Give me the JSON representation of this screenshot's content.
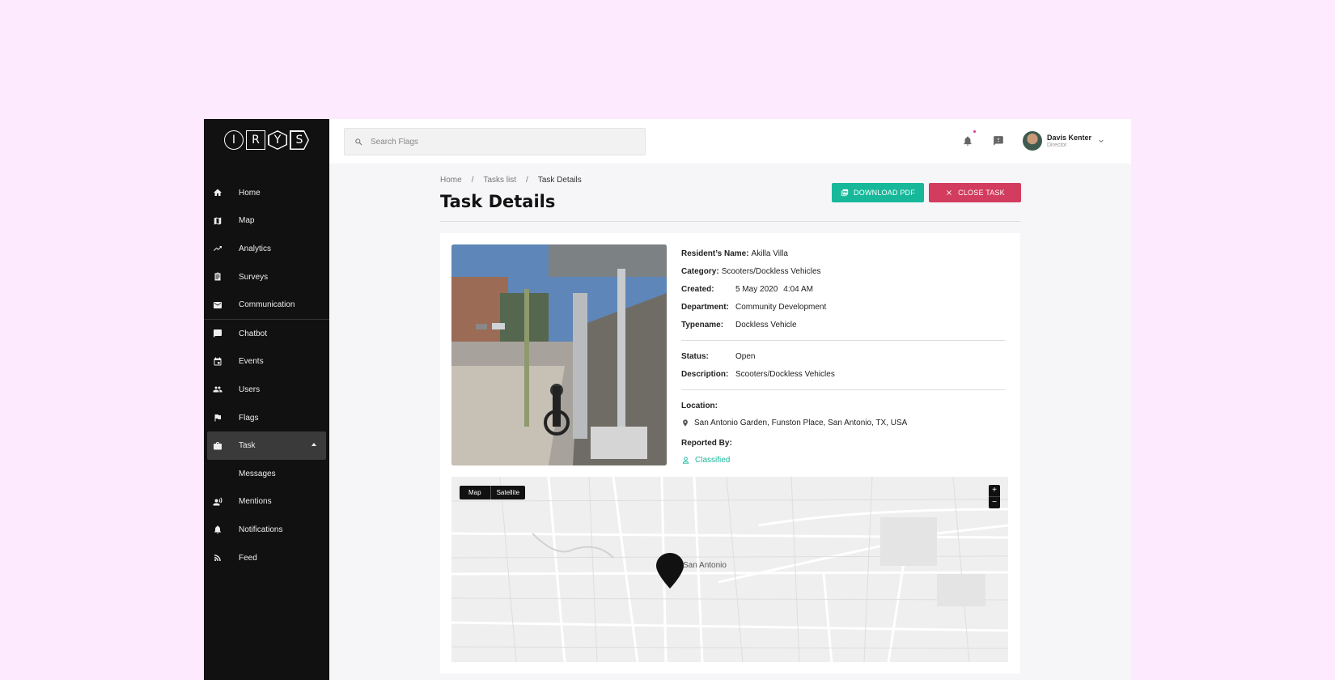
{
  "logo": {
    "letters": [
      "I",
      "R",
      "Y",
      "S"
    ]
  },
  "sidebar": {
    "items": [
      {
        "label": "Home",
        "icon": "home-icon"
      },
      {
        "label": "Map",
        "icon": "map-icon"
      },
      {
        "label": "Analytics",
        "icon": "trending-up-icon"
      },
      {
        "label": "Surveys",
        "icon": "clipboard-icon"
      },
      {
        "label": "Communication",
        "icon": "mail-icon"
      },
      {
        "label": "Chatbot",
        "icon": "chat-icon"
      },
      {
        "label": "Events",
        "icon": "calendar-icon"
      },
      {
        "label": "Users",
        "icon": "people-icon"
      },
      {
        "label": "Flags",
        "icon": "flag-icon"
      },
      {
        "label": "Task",
        "icon": "briefcase-icon"
      },
      {
        "label": "Messages"
      },
      {
        "label": "Mentions",
        "icon": "speaker-person-icon"
      },
      {
        "label": "Notifications",
        "icon": "bell-icon"
      },
      {
        "label": "Feed",
        "icon": "rss-icon"
      }
    ]
  },
  "header": {
    "search_placeholder": "Search Flags",
    "user": {
      "name": "Davis Kenter",
      "role": "Director"
    }
  },
  "breadcrumb": {
    "home": "Home",
    "tasks": "Tasks list",
    "current": "Task Details",
    "sep": "/"
  },
  "page": {
    "title": "Task Details",
    "download_label": "DOWNLOAD PDF",
    "close_label": "CLOSE TASK"
  },
  "details": {
    "resident_label": "Resident’s Name:",
    "resident": "Akilla Villa",
    "category_label": "Category:",
    "category": "Scooters/Dockless Vehicles",
    "created_label": "Created:",
    "created_date": "5 May 2020",
    "created_time": "4:04 AM",
    "department_label": "Department:",
    "department": "Community Development",
    "typename_label": "Typename:",
    "typename": "Dockless Vehicle",
    "status_label": "Status:",
    "status": "Open",
    "description_label": "Description:",
    "description": "Scooters/Dockless Vehicles",
    "location_label": "Location:",
    "location": "San Antonio Garden, Funston Place, San Antonio, TX, USA",
    "reported_label": "Reported By:",
    "reported_by": "Classified"
  },
  "map": {
    "map_label": "Map",
    "satellite_label": "Satellite",
    "zoom_in": "+",
    "zoom_out": "−",
    "city": "San Antonio"
  },
  "colors": {
    "accent": "#17b89a",
    "danger": "#d23c5e",
    "sidebar": "#111111"
  }
}
